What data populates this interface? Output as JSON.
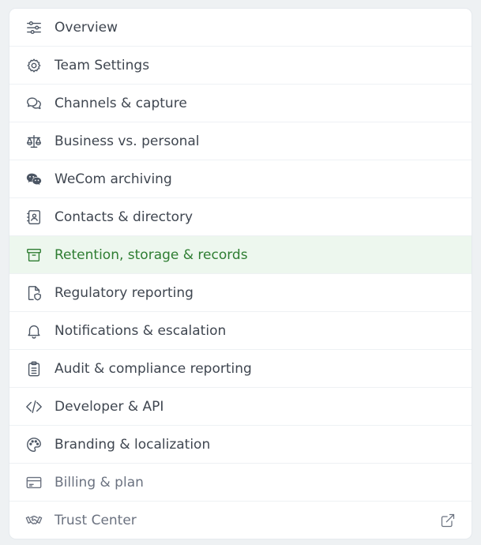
{
  "menu": {
    "items": [
      {
        "label": "Overview",
        "icon": "sliders-icon"
      },
      {
        "label": "Team Settings",
        "icon": "gear-icon"
      },
      {
        "label": "Channels & capture",
        "icon": "chat-bubbles-icon"
      },
      {
        "label": "Business vs. personal",
        "icon": "scale-icon"
      },
      {
        "label": "WeCom archiving",
        "icon": "wechat-icon"
      },
      {
        "label": "Contacts & directory",
        "icon": "contact-card-icon"
      },
      {
        "label": "Retention, storage & records",
        "icon": "archive-box-icon",
        "active": true
      },
      {
        "label": "Regulatory reporting",
        "icon": "file-shield-icon"
      },
      {
        "label": "Notifications & escalation",
        "icon": "bell-icon"
      },
      {
        "label": "Audit & compliance reporting",
        "icon": "clipboard-icon"
      },
      {
        "label": "Developer & API",
        "icon": "code-icon"
      },
      {
        "label": "Branding & localization",
        "icon": "palette-icon"
      },
      {
        "label": "Billing & plan",
        "icon": "credit-card-icon"
      },
      {
        "label": "Trust Center",
        "icon": "handshake-icon",
        "external_icon": "external-link-icon"
      }
    ]
  },
  "colors": {
    "active_bg": "#edf7ee",
    "active_text": "#2e7d32",
    "text": "#3f4650",
    "muted_text": "#6b7280"
  }
}
